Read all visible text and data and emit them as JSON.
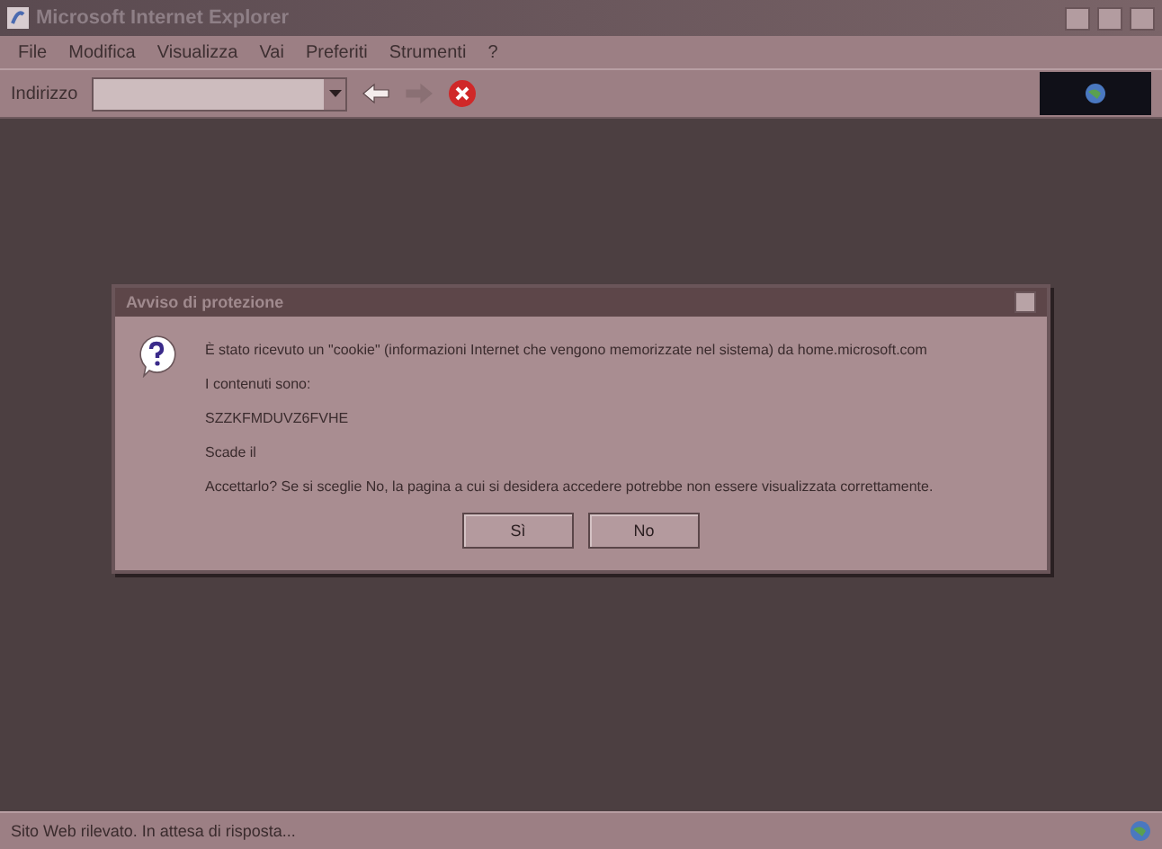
{
  "window": {
    "title": "Microsoft Internet Explorer"
  },
  "menu": [
    "File",
    "Modifica",
    "Visualizza",
    "Vai",
    "Preferiti",
    "Strumenti",
    "?"
  ],
  "address": {
    "label": "Indirizzo"
  },
  "toolbar": [
    {
      "kind": "back",
      "disabled": false
    },
    {
      "kind": "forward",
      "disabled": true
    },
    {
      "kind": "stop",
      "disabled": false
    }
  ],
  "dialog": {
    "title": "Avviso di protezione",
    "lines": [
      "È stato ricevuto un \"cookie\" (informazioni Internet che vengono memorizzate nel sistema) da home.microsoft.com",
      "I contenuti sono:",
      "SZZKFMDUVZ6FVHE",
      "Scade il",
      "Accettarlo? Se si sceglie No, la pagina a cui si desidera accedere potrebbe non essere visualizzata correttamente."
    ],
    "buttons": [
      "Sì",
      "No"
    ]
  },
  "status_bar": {
    "text": "Sito Web rilevato. In attesa di risposta..."
  }
}
